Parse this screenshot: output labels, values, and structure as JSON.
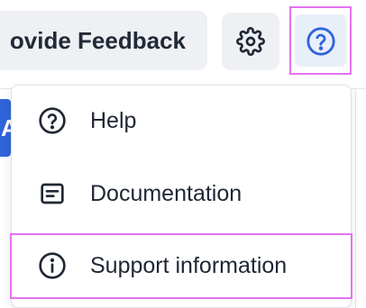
{
  "header": {
    "feedback_label": "ovide Feedback",
    "settings_icon": "gear-icon",
    "help_icon": "question-circle-icon"
  },
  "background": {
    "button_fragment": "A"
  },
  "help_menu": {
    "items": [
      {
        "label": "Help",
        "icon": "question-circle-icon"
      },
      {
        "label": "Documentation",
        "icon": "document-icon"
      },
      {
        "label": "Support information",
        "icon": "info-circle-icon"
      }
    ]
  },
  "colors": {
    "accent_blue": "#2f64db",
    "highlight_magenta": "#e472ef",
    "text": "#1f2735",
    "button_bg": "#eef0f3"
  }
}
